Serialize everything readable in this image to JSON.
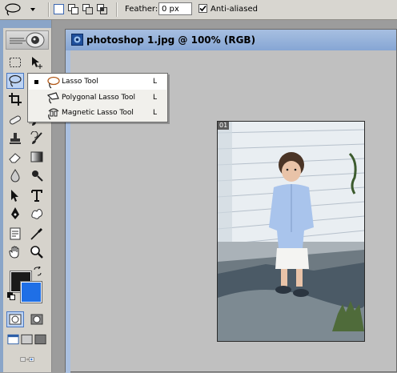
{
  "options_bar": {
    "current_tool_icon": "lasso-icon",
    "selection_modes": [
      "new-selection-icon",
      "add-to-selection-icon",
      "subtract-from-selection-icon",
      "intersect-selection-icon"
    ],
    "feather_label": "Feather:",
    "feather_value": "0 px",
    "anti_aliased_label": "Anti-aliased",
    "anti_aliased_checked": true
  },
  "document": {
    "title": "photoshop 1.jpg @ 100% (RGB)",
    "slice_tag": "01"
  },
  "flyout": {
    "items": [
      {
        "label": "Lasso Tool",
        "shortcut": "L",
        "icon": "lasso-icon",
        "selected": true
      },
      {
        "label": "Polygonal Lasso Tool",
        "shortcut": "L",
        "icon": "polygonal-lasso-icon",
        "selected": false
      },
      {
        "label": "Magnetic Lasso Tool",
        "shortcut": "L",
        "icon": "magnetic-lasso-icon",
        "selected": false
      }
    ]
  },
  "colors": {
    "foreground": "#1a1a1a",
    "background": "#1f6fe6",
    "title_bar": "#95b3dc"
  }
}
